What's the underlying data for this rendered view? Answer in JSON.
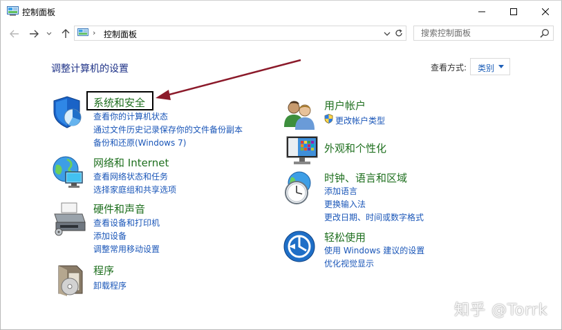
{
  "window": {
    "title": "控制面板"
  },
  "address": {
    "path": "控制面板",
    "separator": "›"
  },
  "search": {
    "placeholder": "搜索控制面板"
  },
  "main": {
    "title": "调整计算机的设置",
    "view_by_label": "查看方式:",
    "view_by_value": "类别"
  },
  "categories": {
    "security": {
      "title": "系统和安全",
      "links": [
        "查看你的计算机状态",
        "通过文件历史记录保存你的文件备份副本",
        "备份和还原(Windows 7)"
      ]
    },
    "network": {
      "title": "网络和 Internet",
      "links": [
        "查看网络状态和任务",
        "选择家庭组和共享选项"
      ]
    },
    "hardware": {
      "title": "硬件和声音",
      "links": [
        "查看设备和打印机",
        "添加设备",
        "调整常用移动设置"
      ]
    },
    "programs": {
      "title": "程序",
      "links": [
        "卸载程序"
      ]
    },
    "accounts": {
      "title": "用户帐户",
      "links": [
        "更改帐户类型"
      ]
    },
    "appearance": {
      "title": "外观和个性化",
      "links": []
    },
    "clock": {
      "title": "时钟、语言和区域",
      "links": [
        "添加语言",
        "更换输入法",
        "更改日期、时间或数字格式"
      ]
    },
    "ease": {
      "title": "轻松使用",
      "links": [
        "使用 Windows 建议的设置",
        "优化视觉显示"
      ]
    }
  },
  "watermark": "知乎 @Torrk",
  "colors": {
    "category_title": "#1e6f1e",
    "link": "#1a56b8",
    "page_title": "#1e3287",
    "annotation_arrow": "#8b1a2a"
  }
}
